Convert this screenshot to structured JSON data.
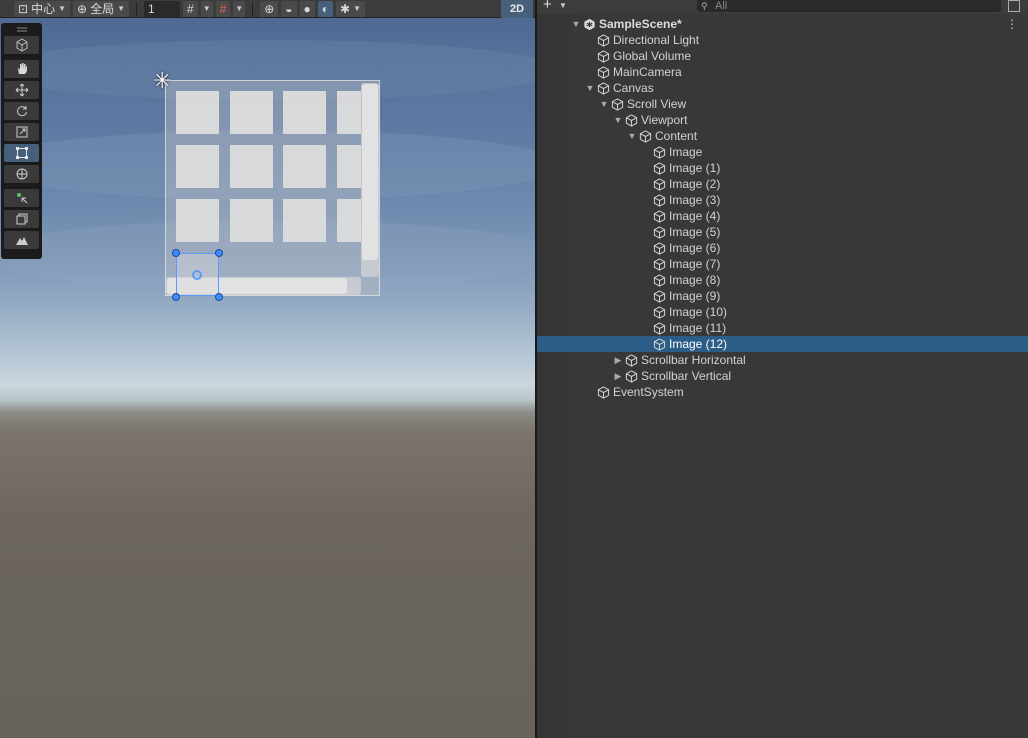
{
  "scene_toolbar": {
    "pivot_label": "中心",
    "global_label": "全局",
    "snap_value": "1",
    "mode_2d_label": "2D"
  },
  "tools": [
    "hand-tool",
    "move-tool",
    "rotate-tool",
    "scale-tool",
    "rect-tool",
    "transform-tool",
    "custom-tool",
    "component-tool",
    "terrain-tool"
  ],
  "hierarchy": {
    "search_placeholder": "All",
    "rows": [
      {
        "label": "SampleScene*",
        "depth": 0,
        "expanded": true,
        "scene": true
      },
      {
        "label": "Directional Light",
        "depth": 1
      },
      {
        "label": "Global Volume",
        "depth": 1
      },
      {
        "label": "MainCamera",
        "depth": 1
      },
      {
        "label": "Canvas",
        "depth": 1,
        "expanded": true
      },
      {
        "label": "Scroll View",
        "depth": 2,
        "expanded": true
      },
      {
        "label": "Viewport",
        "depth": 3,
        "expanded": true
      },
      {
        "label": "Content",
        "depth": 4,
        "expanded": true
      },
      {
        "label": "Image",
        "depth": 5
      },
      {
        "label": "Image (1)",
        "depth": 5
      },
      {
        "label": "Image (2)",
        "depth": 5
      },
      {
        "label": "Image (3)",
        "depth": 5
      },
      {
        "label": "Image (4)",
        "depth": 5
      },
      {
        "label": "Image (5)",
        "depth": 5
      },
      {
        "label": "Image (6)",
        "depth": 5
      },
      {
        "label": "Image (7)",
        "depth": 5
      },
      {
        "label": "Image (8)",
        "depth": 5
      },
      {
        "label": "Image (9)",
        "depth": 5
      },
      {
        "label": "Image (10)",
        "depth": 5
      },
      {
        "label": "Image (11)",
        "depth": 5
      },
      {
        "label": "Image (12)",
        "depth": 5,
        "selected": true
      },
      {
        "label": "Scrollbar Horizontal",
        "depth": 3,
        "expanded": false
      },
      {
        "label": "Scrollbar Vertical",
        "depth": 3,
        "expanded": false
      },
      {
        "label": "EventSystem",
        "depth": 1
      }
    ]
  },
  "colors": {
    "selection": "#2c5d87",
    "handle": "#3b8cff",
    "panel_bg": "#383838"
  }
}
